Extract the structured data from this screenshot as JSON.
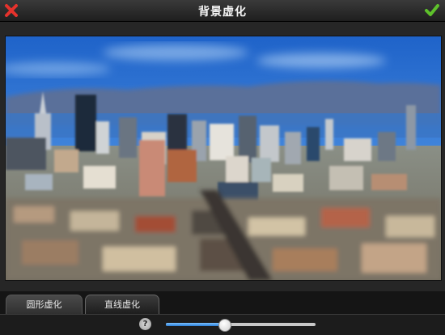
{
  "header": {
    "title": "背景虚化",
    "cancel_icon": "close-x-icon",
    "confirm_icon": "checkmark-icon"
  },
  "photo": {
    "subject": "city-skyline-tilt-shift"
  },
  "tabs": [
    {
      "label": "圆形虚化",
      "selected": false
    },
    {
      "label": "直线虚化",
      "selected": true
    }
  ],
  "controls": {
    "help_label": "?",
    "blur_level": 0.39
  },
  "colors": {
    "cancel": "#e5322c",
    "confirm": "#5ec12b",
    "slider_fill": "#2a7ed6"
  }
}
